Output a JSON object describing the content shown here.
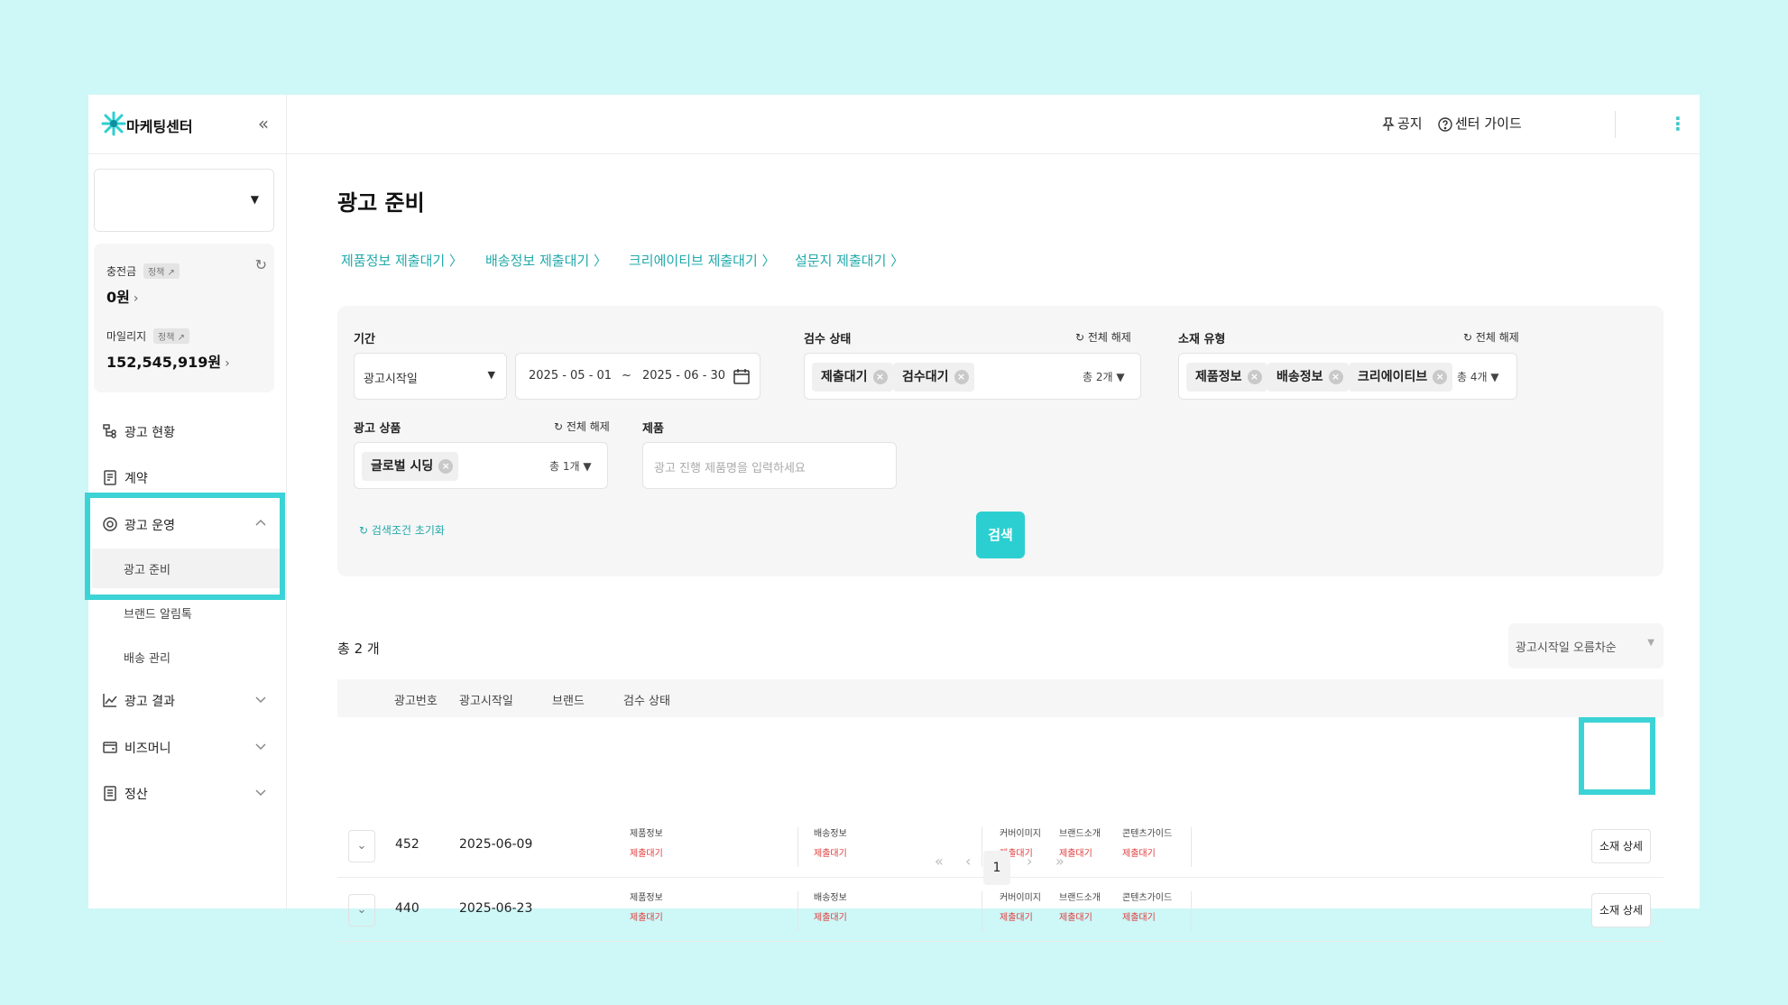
{
  "app": {
    "name": "마케팅센터"
  },
  "sidebar": {
    "account_caret": "▼",
    "balance": {
      "charge_label": "충전금",
      "charge_tag": "정책 ↗",
      "charge_value": "0원",
      "mileage_label": "마일리지",
      "mileage_tag": "정책 ↗",
      "mileage_value": "152,545,919원"
    },
    "nav": [
      {
        "label": "광고 현황",
        "icon": "ad-status-icon"
      },
      {
        "label": "계약",
        "icon": "contract-icon"
      },
      {
        "label": "광고 운영",
        "icon": "ad-operation-icon"
      },
      {
        "label": "광고 결과",
        "icon": "chart-line-icon"
      },
      {
        "label": "비즈머니",
        "icon": "wallet-icon"
      },
      {
        "label": "정산",
        "icon": "receipt-icon"
      }
    ],
    "sub_items": [
      "광고 준비",
      "브랜드 알림톡",
      "배송 관리"
    ]
  },
  "topbar": {
    "notice": "공지",
    "guide": "센터 가이드"
  },
  "page": {
    "title": "광고 준비",
    "steps": [
      "제품정보 제출대기",
      "배송정보 제출대기",
      "크리에이티브 제출대기",
      "설문지 제출대기"
    ]
  },
  "filters": {
    "period": {
      "label": "기간",
      "type_value": "광고시작일",
      "start": "2025 - 05 - 01",
      "sep": "~",
      "end": "2025 - 06 - 30"
    },
    "review": {
      "label": "검수 상태",
      "reset": "전체 해제",
      "chips": [
        "제출대기",
        "검수대기"
      ],
      "count": "총 2개"
    },
    "material": {
      "label": "소재 유형",
      "reset": "전체 해제",
      "chips": [
        "제품정보",
        "배송정보",
        "크리에이티브"
      ],
      "count": "총 4개"
    },
    "product_type": {
      "label": "광고 상품",
      "reset": "전체 해제",
      "chips": [
        "글로벌 시딩"
      ],
      "count": "총 1개"
    },
    "product": {
      "label": "제품",
      "placeholder": "광고 진행 제품명을 입력하세요"
    },
    "reset_all": "검색조건 초기화",
    "search": "검색"
  },
  "results": {
    "total": "총 2 개",
    "sort": "광고시작일 오름차순",
    "columns": [
      "광고번호",
      "광고시작일",
      "브랜드",
      "검수 상태"
    ],
    "rows": [
      {
        "id": "452",
        "date": "2025-06-09",
        "statuses": [
          {
            "name": "제품정보",
            "state": "제출대기"
          },
          {
            "name": "배송정보",
            "state": "제출대기"
          },
          {
            "name": "커버이미지",
            "state": "제출대기"
          },
          {
            "name": "브랜드소개",
            "state": "제출대기"
          },
          {
            "name": "콘텐츠가이드",
            "state": "제출대기"
          }
        ],
        "detail": "소재 상세"
      },
      {
        "id": "440",
        "date": "2025-06-23",
        "statuses": [
          {
            "name": "제품정보",
            "state": "제출대기"
          },
          {
            "name": "배송정보",
            "state": "제출대기"
          },
          {
            "name": "커버이미지",
            "state": "제출대기"
          },
          {
            "name": "브랜드소개",
            "state": "제출대기"
          },
          {
            "name": "콘텐츠가이드",
            "state": "제출대기"
          }
        ],
        "detail": "소재 상세"
      }
    ]
  },
  "pagination": {
    "current": "1",
    "first": "«",
    "prev": "‹",
    "next": "›",
    "last": "»"
  },
  "colors": {
    "accent": "#2ccfd1",
    "link": "#22a9ab",
    "highlight": "#3cd3d6",
    "status_red": "#e03b3b"
  }
}
